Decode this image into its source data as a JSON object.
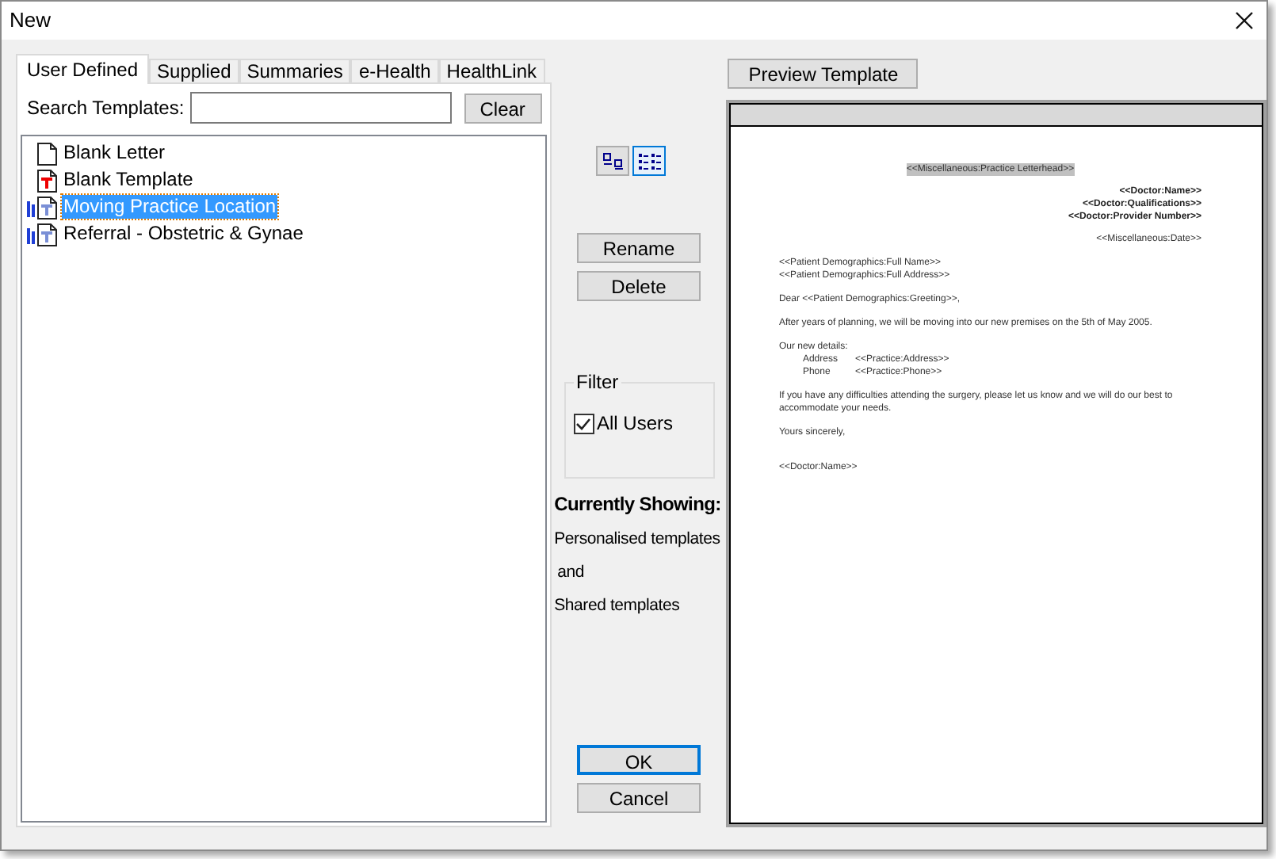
{
  "window": {
    "title": "New"
  },
  "tabs": [
    {
      "label": "User Defined",
      "selected": true
    },
    {
      "label": "Supplied",
      "selected": false
    },
    {
      "label": "Summaries",
      "selected": false
    },
    {
      "label": "e-Health",
      "selected": false
    },
    {
      "label": "HealthLink",
      "selected": false
    }
  ],
  "search": {
    "label": "Search Templates:",
    "clear": "Clear"
  },
  "templates": [
    {
      "name": "Blank Letter",
      "kind": "blank",
      "shared": false,
      "selected": false
    },
    {
      "name": "Blank Template",
      "kind": "template",
      "shared": false,
      "selected": false
    },
    {
      "name": "Moving Practice Location",
      "kind": "template",
      "shared": true,
      "selected": true
    },
    {
      "name": "Referral - Obstetric & Gynae",
      "kind": "template",
      "shared": true,
      "selected": false
    }
  ],
  "view_buttons": [
    {
      "kind": "large",
      "selected": false
    },
    {
      "kind": "list",
      "selected": true
    }
  ],
  "actions": [
    "Rename",
    "Delete"
  ],
  "filter": {
    "title": "Filter",
    "option": {
      "label": "All Users",
      "checked": true
    }
  },
  "currently_showing": {
    "heading": "Currently Showing:",
    "lines": [
      "Personalised templates",
      "and",
      "Shared templates"
    ]
  },
  "buttons": [
    {
      "label": "OK",
      "default": true
    },
    {
      "label": "Cancel",
      "default": false
    }
  ],
  "preview": {
    "button": "Preview Template",
    "lines": [
      {
        "kind": "letterhead",
        "text": "<<Miscellaneous:Practice Letterhead>>"
      },
      {
        "kind": "doctor",
        "text": "<<Doctor:Name>>"
      },
      {
        "kind": "doctor",
        "text": "<<Doctor:Qualifications>>"
      },
      {
        "kind": "doctor",
        "text": "<<Doctor:Provider Number>>"
      },
      {
        "kind": "date",
        "text": "<<Miscellaneous:Date>>"
      },
      {
        "kind": "text",
        "text": "<<Patient Demographics:Full Name>>",
        "gap": true
      },
      {
        "kind": "text",
        "text": "<<Patient Demographics:Full Address>>",
        "gap": false
      },
      {
        "kind": "text",
        "text": "Dear <<Patient Demographics:Greeting>>,",
        "gap": true
      },
      {
        "kind": "text",
        "text": "After years of planning, we will be moving into our new premises on the 5th of May 2005.",
        "gap": true
      },
      {
        "kind": "text",
        "text": "Our new details:",
        "gap": true
      },
      {
        "kind": "detail",
        "label": "Address",
        "text": "<<Practice:Address>>"
      },
      {
        "kind": "detail",
        "label": "Phone",
        "text": "<<Practice:Phone>>"
      },
      {
        "kind": "text",
        "text": "If you have any difficulties attending the surgery, please let us know and we will do our best to accommodate your needs.",
        "gap": true
      },
      {
        "kind": "text",
        "text": "Yours sincerely,",
        "gap": true
      },
      {
        "kind": "signature",
        "text": "<<Doctor:Name>>"
      }
    ]
  }
}
